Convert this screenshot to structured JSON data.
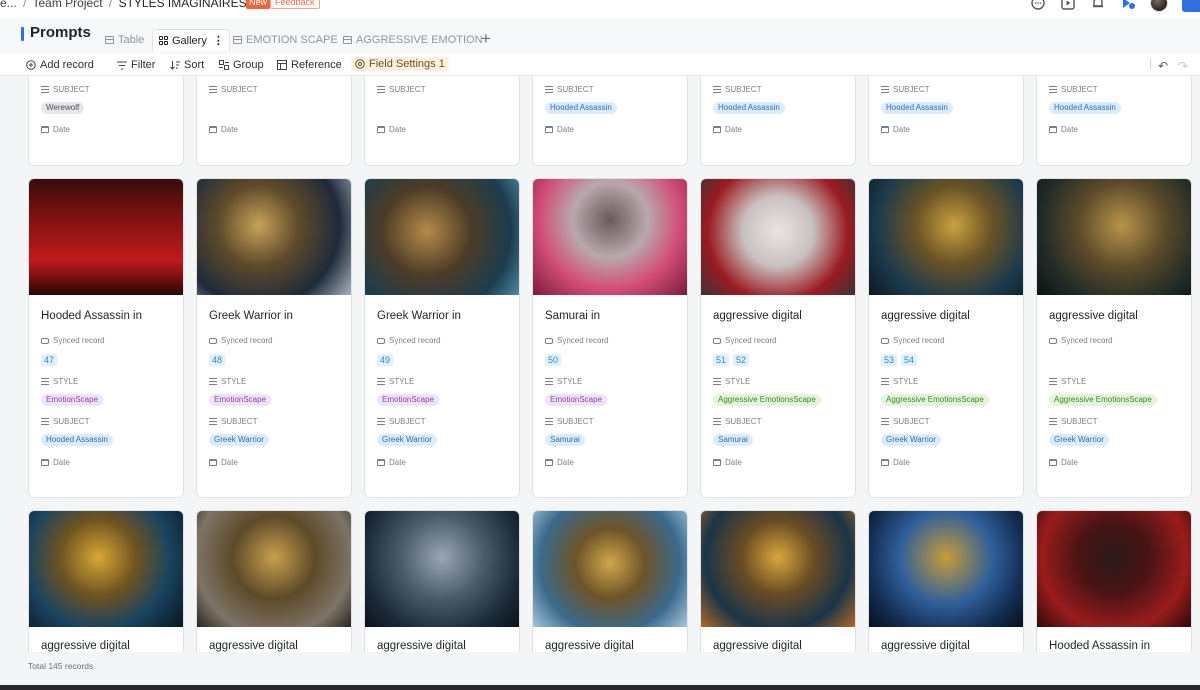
{
  "header": {
    "crumb_prefix": "e...",
    "sep": "/",
    "project": "Team Project",
    "base": "STYLES IMAGINAIRES",
    "badge_new": "New",
    "badge_feedback": "Feedback"
  },
  "table": {
    "title": "Prompts",
    "views": [
      {
        "label": "Table",
        "active": false
      },
      {
        "label": "Gallery",
        "active": true
      },
      {
        "label": "EMOTION SCAPE",
        "active": false
      },
      {
        "label": "AGGRESSIVE EMOTION",
        "active": false
      }
    ]
  },
  "toolbar": {
    "add_record": "Add record",
    "filter": "Filter",
    "sort": "Sort",
    "group": "Group",
    "reference": "Reference",
    "field_settings": "Field Settings 1"
  },
  "fields": {
    "subject": "SUBJECT",
    "style": "STYLE",
    "date": "Date",
    "synced": "Synced record"
  },
  "top_row": [
    {
      "subject": "Werewolf",
      "subject_color": "gray"
    },
    {
      "subject": "",
      "subject_color": ""
    },
    {
      "subject": "",
      "subject_color": ""
    },
    {
      "subject": "Hooded Assassin",
      "subject_color": "blue"
    },
    {
      "subject": "Hooded Assassin",
      "subject_color": "blue"
    },
    {
      "subject": "Hooded Assassin",
      "subject_color": "blue"
    },
    {
      "subject": "Hooded Assassin",
      "subject_color": "blue"
    }
  ],
  "middle_row": [
    {
      "title": "Hooded Assassin in",
      "synced": [
        "47"
      ],
      "style": "EmotionScape",
      "style_color": "purple",
      "subject": "Hooded Assassin",
      "subject_color": "blue",
      "image_palette": "red-forest"
    },
    {
      "title": "Greek Warrior in",
      "synced": [
        "48"
      ],
      "style": "EmotionScape",
      "style_color": "purple",
      "subject": "Greek Warrior",
      "subject_color": "blue",
      "image_palette": "bronze-helmet"
    },
    {
      "title": "Greek Warrior in",
      "synced": [
        "49"
      ],
      "style": "EmotionScape",
      "style_color": "purple",
      "subject": "Greek Warrior",
      "subject_color": "blue",
      "image_palette": "bronze-sea"
    },
    {
      "title": "Samurai in",
      "synced": [
        "50"
      ],
      "style": "EmotionScape",
      "style_color": "purple",
      "subject": "Samurai",
      "subject_color": "blue",
      "image_palette": "pink-blossom"
    },
    {
      "title": "aggressive digital",
      "synced": [
        "51",
        "52"
      ],
      "style": "Aggressive EmotionsScape",
      "style_color": "green",
      "subject": "Samurai",
      "subject_color": "blue",
      "image_palette": "ink-red"
    },
    {
      "title": "aggressive digital",
      "synced": [
        "53",
        "54"
      ],
      "style": "Aggressive EmotionsScape",
      "style_color": "green",
      "subject": "Greek Warrior",
      "subject_color": "blue",
      "image_palette": "gold-teal"
    },
    {
      "title": "aggressive digital",
      "synced": [],
      "style": "Aggressive EmotionsScape",
      "style_color": "green",
      "subject": "Greek Warrior",
      "subject_color": "blue",
      "image_palette": "gold-dark"
    }
  ],
  "bottom_row": [
    {
      "title": "aggressive digital",
      "image_palette": "gold-blue"
    },
    {
      "title": "aggressive digital",
      "image_palette": "gold-smoke"
    },
    {
      "title": "aggressive digital",
      "image_palette": "steel-blue"
    },
    {
      "title": "aggressive digital",
      "image_palette": "gold-sky"
    },
    {
      "title": "aggressive digital",
      "image_palette": "gold-fire"
    },
    {
      "title": "aggressive digital",
      "image_palette": "blue-gold"
    },
    {
      "title": "Hooded Assassin in",
      "image_palette": "red-hood"
    }
  ],
  "footer": {
    "total": "Total 145 records"
  },
  "colors": {
    "accent": "#2f6fe0",
    "new_badge": "#f0643c"
  }
}
